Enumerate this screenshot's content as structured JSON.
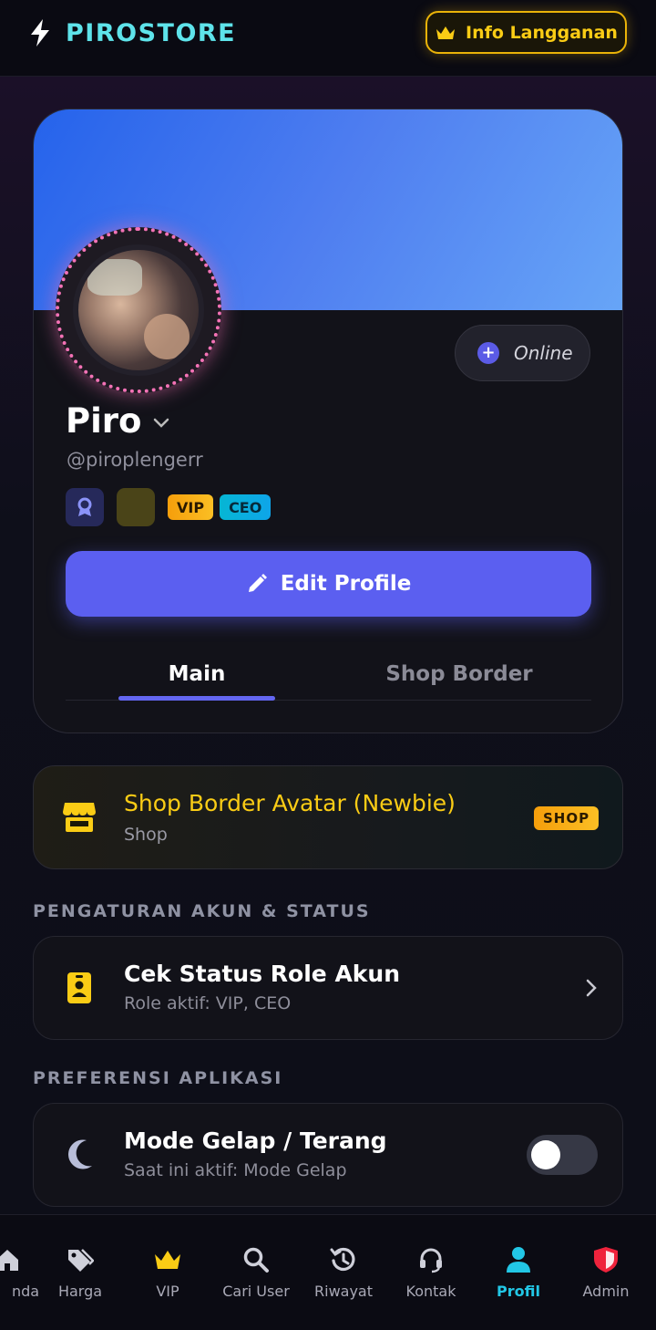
{
  "header": {
    "brand": "PIROSTORE",
    "info_button": "Info Langganan"
  },
  "profile": {
    "status": "Online",
    "name": "Piro",
    "handle": "@piroplengerr",
    "tags": [
      "VIP",
      "CEO"
    ],
    "edit_button": "Edit Profile",
    "tabs": [
      {
        "label": "Main",
        "active": true
      },
      {
        "label": "Shop Border",
        "active": false
      }
    ]
  },
  "shop_card": {
    "title": "Shop Border Avatar (Newbie)",
    "subtitle": "Shop",
    "tag": "SHOP"
  },
  "sections": {
    "account": {
      "label": "PENGATURAN AKUN & STATUS",
      "item_title": "Cek Status Role Akun",
      "item_sub": "Role aktif: VIP, CEO"
    },
    "preferences": {
      "label": "PREFERENSI APLIKASI",
      "item_title": "Mode Gelap / Terang",
      "item_sub": "Saat ini aktif: Mode Gelap",
      "toggle_on": false
    }
  },
  "nav": {
    "items": [
      {
        "label": "nda",
        "icon": "home-icon"
      },
      {
        "label": "Harga",
        "icon": "tags-icon"
      },
      {
        "label": "VIP",
        "icon": "crown-icon"
      },
      {
        "label": "Cari User",
        "icon": "search-icon"
      },
      {
        "label": "Riwayat",
        "icon": "history-icon"
      },
      {
        "label": "Kontak",
        "icon": "headset-icon"
      },
      {
        "label": "Profil",
        "icon": "user-icon",
        "active": true
      },
      {
        "label": "Admin",
        "icon": "shield-icon"
      }
    ]
  },
  "colors": {
    "brand": "#5ee3ea",
    "accent": "#5b5ff0",
    "gold": "#facc15",
    "active_nav": "#22c7e6"
  }
}
